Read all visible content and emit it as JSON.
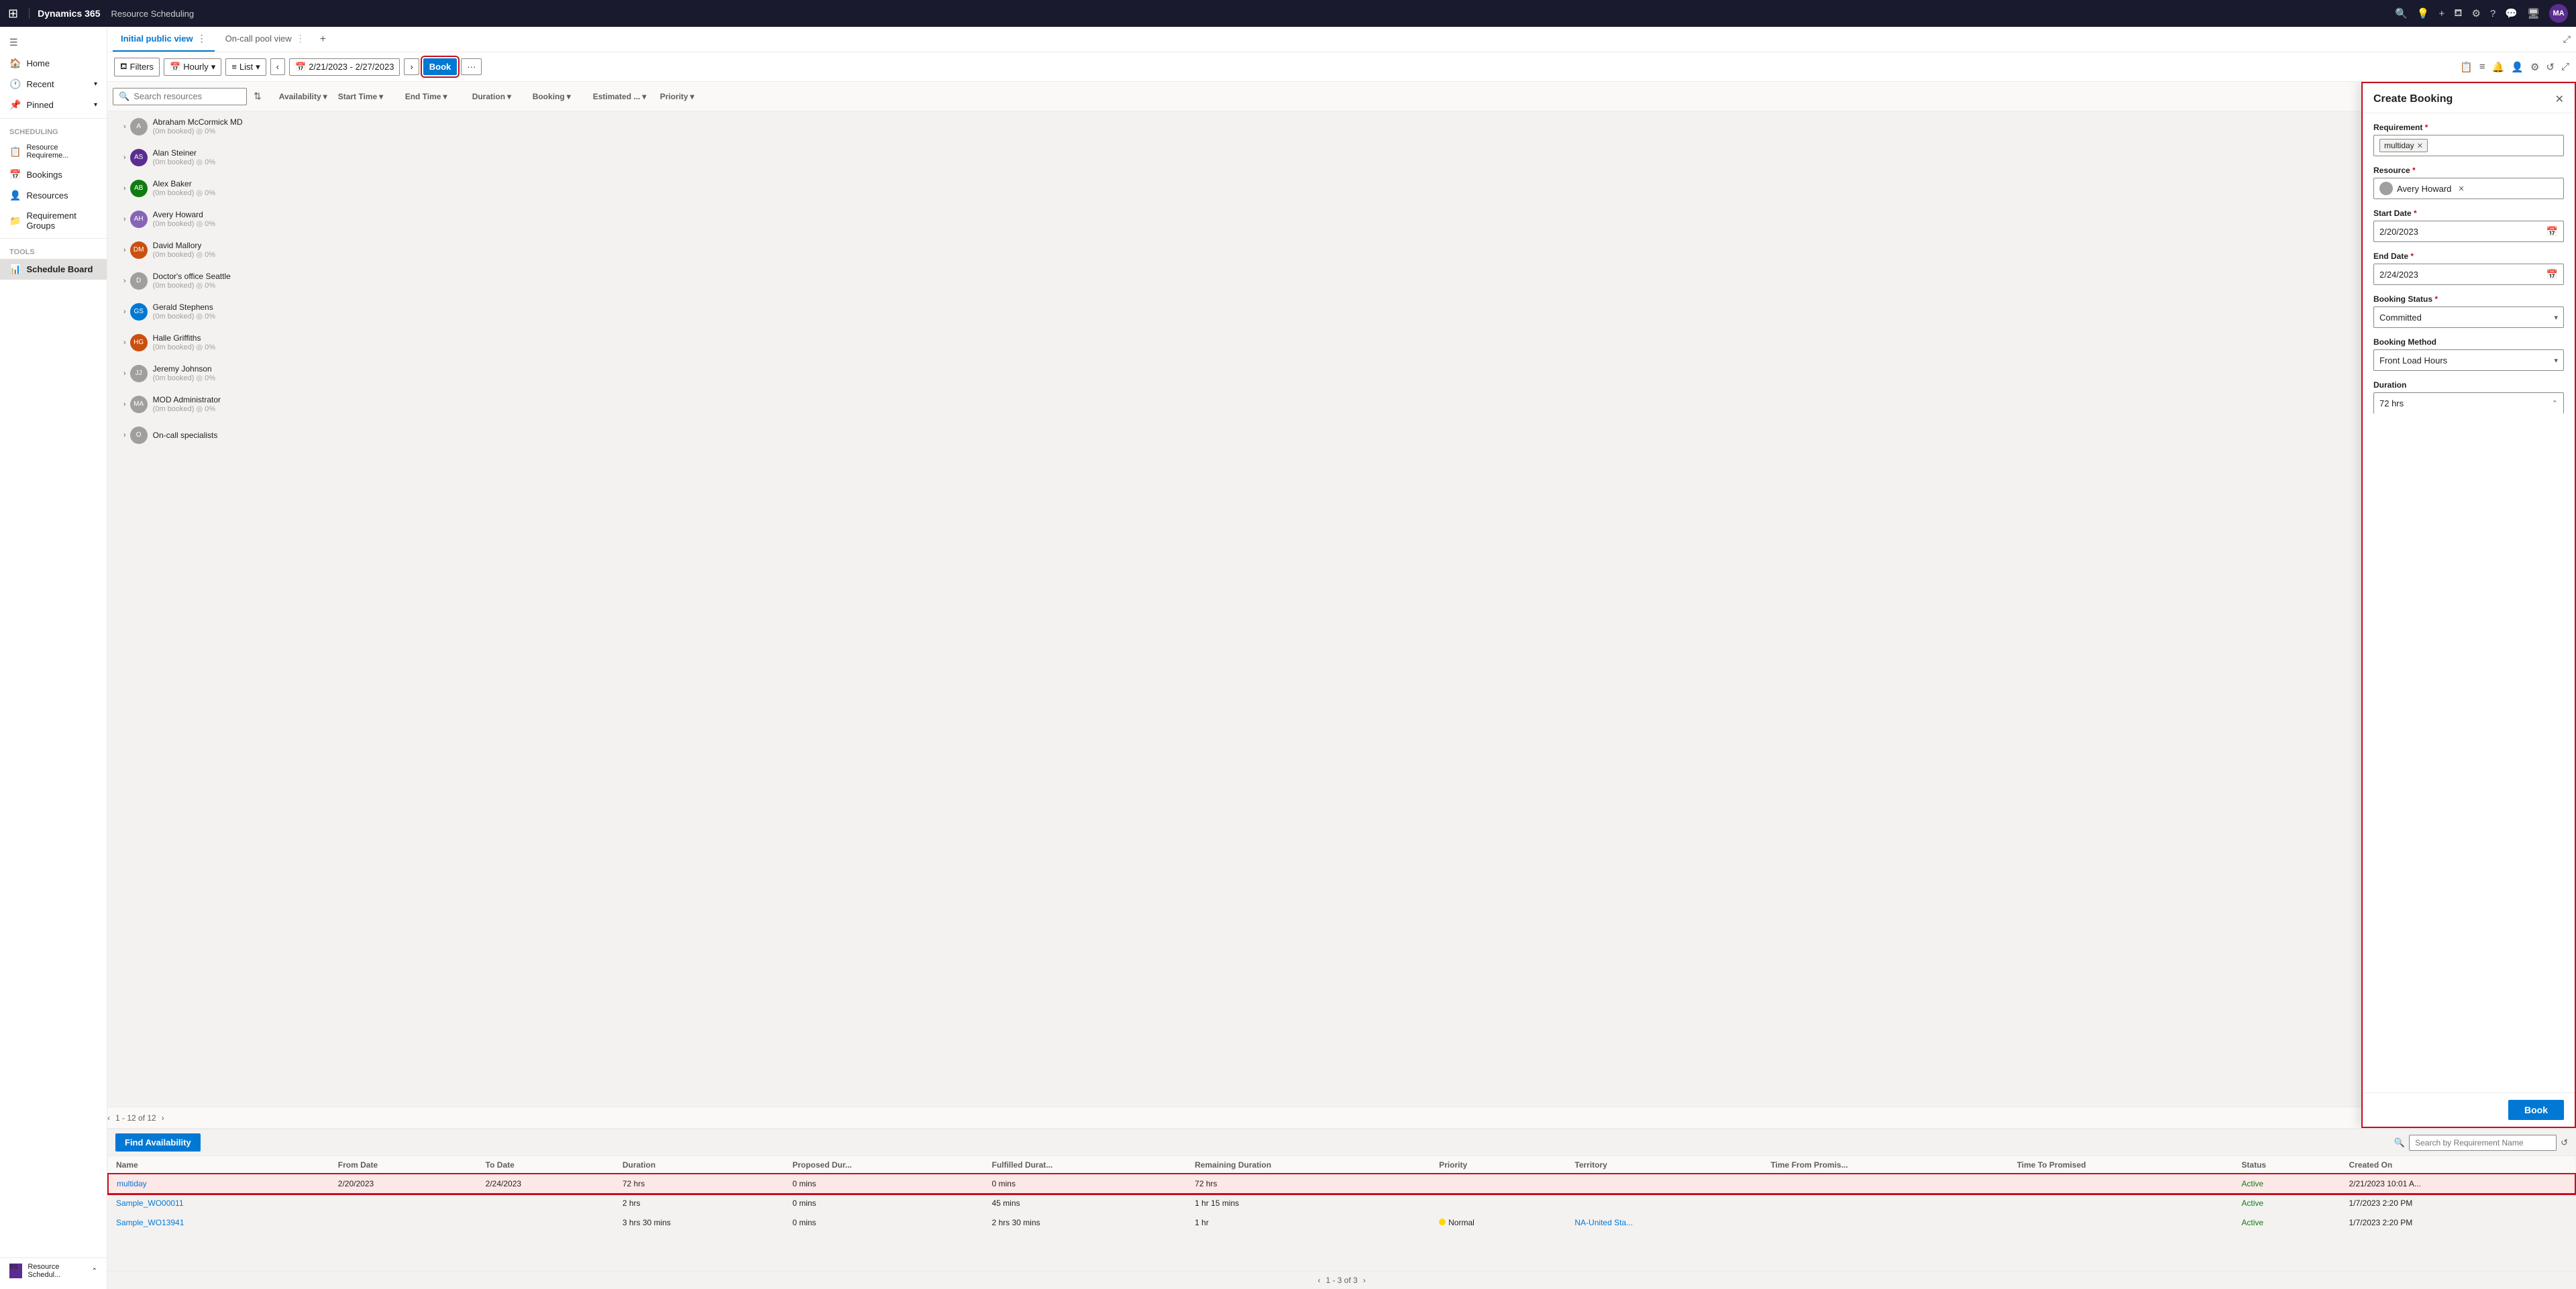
{
  "app": {
    "waffle": "⊞",
    "name": "Dynamics 365",
    "separator": "|",
    "module": "Resource Scheduling"
  },
  "topnav": {
    "icons": [
      "🔍",
      "💬",
      "+",
      "⛾",
      "⚙",
      "?",
      "💬"
    ],
    "avatar": "MA"
  },
  "sidebar": {
    "collapse_icon": "☰",
    "items": [
      {
        "label": "Home",
        "icon": "🏠"
      },
      {
        "label": "Recent",
        "icon": "🕐",
        "expandable": true
      },
      {
        "label": "Pinned",
        "icon": "📌",
        "expandable": true
      }
    ],
    "sections": [
      {
        "title": "Scheduling",
        "items": [
          {
            "label": "Resource Requireme...",
            "icon": "📋"
          },
          {
            "label": "Bookings",
            "icon": "📅"
          },
          {
            "label": "Resources",
            "icon": "👤"
          },
          {
            "label": "Requirement Groups",
            "icon": "📁"
          }
        ]
      },
      {
        "title": "Tools",
        "items": [
          {
            "label": "Schedule Board",
            "icon": "📊",
            "active": true
          }
        ]
      }
    ],
    "footer": {
      "label": "Resource Schedul...",
      "icon": "RS"
    }
  },
  "tabs": [
    {
      "label": "Initial public view",
      "active": true
    },
    {
      "label": "On-call pool view",
      "active": false
    }
  ],
  "toolbar": {
    "filters_label": "Filters",
    "view_label": "Hourly",
    "list_label": "List",
    "date_range": "2/21/2023 - 2/27/2023",
    "book_label": "Book",
    "more_icon": "···",
    "right_icons": [
      "📋",
      "≡",
      "🔔",
      "👤",
      "⚙",
      "↺",
      "⤢"
    ]
  },
  "resource_header": {
    "search_placeholder": "Search resources",
    "sort_icon": "⇅",
    "columns": [
      {
        "label": "Availability",
        "sort": "▾"
      },
      {
        "label": "Start Time",
        "sort": "▾"
      },
      {
        "label": "End Time",
        "sort": "▾"
      },
      {
        "label": "Duration",
        "sort": "▾"
      },
      {
        "label": "Booking",
        "sort": "▾"
      },
      {
        "label": "Estimated ...",
        "sort": "▾"
      },
      {
        "label": "Priority",
        "sort": "▾"
      }
    ]
  },
  "resources": [
    {
      "name": "Abraham McCormick MD",
      "sub": "(0m booked) ◎ 0%",
      "avatar_color": "#a19f9d",
      "avatar_text": "A"
    },
    {
      "name": "Alan Steiner",
      "sub": "(0m booked) ◎ 0%",
      "avatar_color": "#5c2d91",
      "avatar_text": "AS"
    },
    {
      "name": "Alex Baker",
      "sub": "(0m booked) ◎ 0%",
      "avatar_color": "#107c10",
      "avatar_text": "AB"
    },
    {
      "name": "Avery Howard",
      "sub": "(0m booked) ◎ 0%",
      "avatar_color": "#8764b8",
      "avatar_text": "AH"
    },
    {
      "name": "David Mallory",
      "sub": "(0m booked) ◎ 0%",
      "avatar_color": "#d13438",
      "avatar_text": "DM"
    },
    {
      "name": "Doctor's office Seattle",
      "sub": "(0m booked) ◎ 0%",
      "avatar_color": "#a19f9d",
      "avatar_text": "D"
    },
    {
      "name": "Gerald Stephens",
      "sub": "(0m booked) ◎ 0%",
      "avatar_color": "#0078d4",
      "avatar_text": "GS"
    },
    {
      "name": "Halle Griffiths",
      "sub": "(0m booked) ◎ 0%",
      "avatar_color": "#ca5010",
      "avatar_text": "HG"
    },
    {
      "name": "Jeremy Johnson",
      "sub": "(0m booked) ◎ 0%",
      "avatar_color": "#a19f9d",
      "avatar_text": "JJ"
    },
    {
      "name": "MOD Administrator",
      "sub": "(0m booked) ◎ 0%",
      "avatar_color": "#a19f9d",
      "avatar_text": "MA"
    },
    {
      "name": "On-call specialists",
      "sub": "",
      "avatar_color": "#a19f9d",
      "avatar_text": "O"
    }
  ],
  "pagination": {
    "prev": "‹",
    "range": "1 - 12 of 12",
    "next": "›"
  },
  "bottom_panel": {
    "find_availability_label": "Find Availability",
    "search_placeholder": "Search by Requirement Name",
    "columns": [
      "Name",
      "From Date",
      "To Date",
      "Duration",
      "Proposed Dur...",
      "Fulfilled Durat...",
      "Remaining Duration",
      "Priority",
      "Territory",
      "Time From Promis...",
      "Time To Promised",
      "Status",
      "Created On"
    ],
    "rows": [
      {
        "name": "multiday",
        "from_date": "2/20/2023",
        "to_date": "2/24/2023",
        "duration": "72 hrs",
        "proposed_dur": "0 mins",
        "fulfilled_dur": "0 mins",
        "remaining": "72 hrs",
        "priority": "",
        "territory": "",
        "time_from": "",
        "time_to": "",
        "status": "Active",
        "created_on": "2/21/2023 10:01 A...",
        "selected": true
      },
      {
        "name": "Sample_WO00011",
        "from_date": "",
        "to_date": "",
        "duration": "2 hrs",
        "proposed_dur": "0 mins",
        "fulfilled_dur": "45 mins",
        "remaining": "1 hr 15 mins",
        "priority": "",
        "territory": "",
        "time_from": "",
        "time_to": "",
        "status": "Active",
        "created_on": "1/7/2023 2:20 PM",
        "selected": false
      },
      {
        "name": "Sample_WO13941",
        "from_date": "",
        "to_date": "",
        "duration": "3 hrs 30 mins",
        "proposed_dur": "0 mins",
        "fulfilled_dur": "2 hrs 30 mins",
        "remaining": "1 hr",
        "priority": "Normal",
        "territory": "NA-United Sta...",
        "time_from": "",
        "time_to": "",
        "status": "Active",
        "created_on": "1/7/2023 2:20 PM",
        "selected": false
      }
    ],
    "table_pagination": {
      "prev": "‹",
      "range": "1 - 3 of 3",
      "next": "›"
    }
  },
  "booking_panel": {
    "title": "Create Booking",
    "close_icon": "✕",
    "fields": {
      "requirement_label": "Requirement",
      "requirement_required": "*",
      "requirement_value": "multiday",
      "resource_label": "Resource",
      "resource_required": "*",
      "resource_value": "Avery Howard",
      "start_date_label": "Start Date",
      "start_date_required": "*",
      "start_date_value": "2/20/2023",
      "end_date_label": "End Date",
      "end_date_required": "*",
      "end_date_value": "2/24/2023",
      "booking_status_label": "Booking Status",
      "booking_status_required": "*",
      "booking_status_value": "Committed",
      "booking_method_label": "Booking Method",
      "booking_method_value": "Front Load Hours",
      "duration_label": "Duration",
      "duration_value": "72 hrs"
    },
    "book_label": "Book"
  }
}
